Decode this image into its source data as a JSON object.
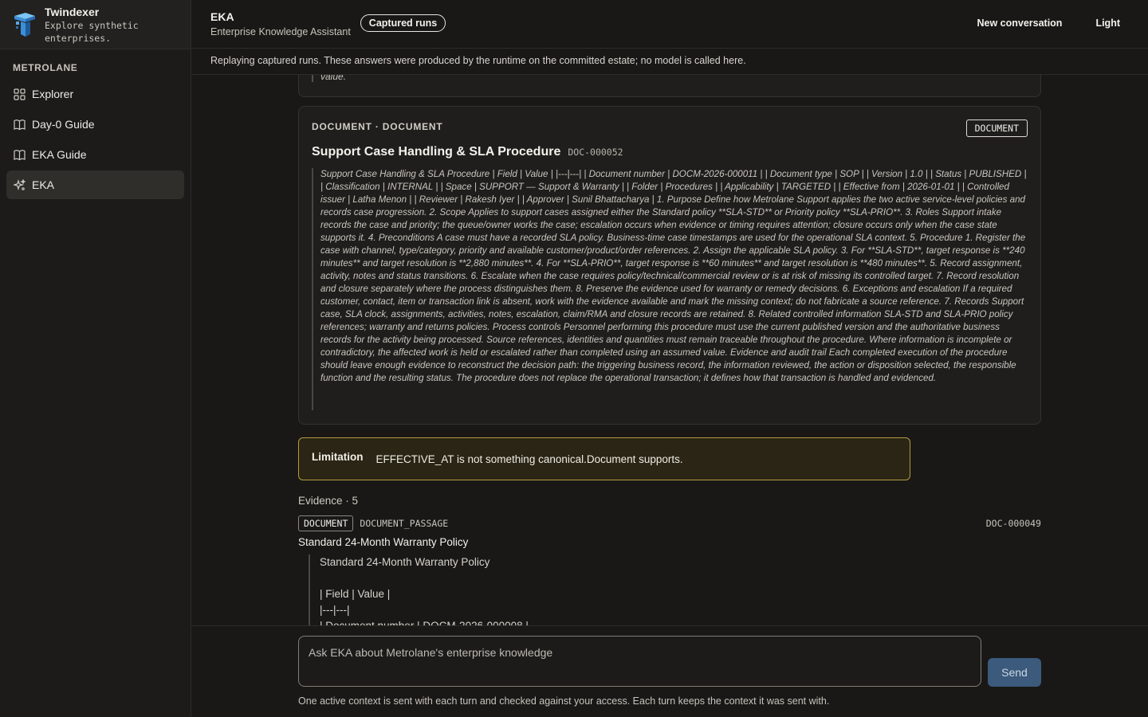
{
  "brand": {
    "name": "Twindexer",
    "tagline": "Explore synthetic enterprises."
  },
  "sidebar": {
    "section": "METROLANE",
    "items": [
      {
        "label": "Explorer",
        "icon": "grid-icon"
      },
      {
        "label": "Day-0 Guide",
        "icon": "book-icon"
      },
      {
        "label": "EKA Guide",
        "icon": "book-icon"
      },
      {
        "label": "EKA",
        "icon": "sparkle-icon",
        "active": true
      }
    ]
  },
  "header": {
    "title": "EKA",
    "subtitle": "Enterprise Knowledge Assistant",
    "badge": "Captured runs",
    "new_conversation": "New conversation",
    "theme": "Light"
  },
  "notice": "Replaying captured runs. These answers were produced by the runtime on the committed estate; no model is called here.",
  "previous_tail": "value.",
  "document": {
    "kicker": "DOCUMENT · DOCUMENT",
    "tag": "DOCUMENT",
    "title": "Support Case Handling & SLA Procedure",
    "id": "DOC-000052",
    "body": "Support Case Handling & SLA Procedure | Field | Value | |---|---| | Document number | DOCM-2026-000011 | | Document type | SOP | | Version | 1.0 | | Status | PUBLISHED | | Classification | INTERNAL | | Space | SUPPORT — Support & Warranty | | Folder | Procedures | | Applicability | TARGETED | | Effective from | 2026-01-01 | | Controlled issuer | Latha Menon | | Reviewer | Rakesh Iyer | | Approver | Sunil Bhattacharya | 1. Purpose Define how Metrolane Support applies the two active service-level policies and records case progression. 2. Scope Applies to support cases assigned either the Standard policy **SLA-STD** or Priority policy **SLA-PRIO**. 3. Roles Support intake records the case and priority; the queue/owner works the case; escalation occurs when evidence or timing requires attention; closure occurs only when the case state supports it. 4. Preconditions A case must have a recorded SLA policy. Business-time case timestamps are used for the operational SLA context. 5. Procedure 1. Register the case with channel, type/category, priority and available customer/product/order references. 2. Assign the applicable SLA policy. 3. For **SLA-STD**, target response is **240 minutes** and target resolution is **2,880 minutes**. 4. For **SLA-PRIO**, target response is **60 minutes** and target resolution is **480 minutes**. 5. Record assignment, activity, notes and status transitions. 6. Escalate when the case requires policy/technical/commercial review or is at risk of missing its controlled target. 7. Record resolution and closure separately where the process distinguishes them. 8. Preserve the evidence used for warranty or remedy decisions. 6. Exceptions and escalation If a required customer, contact, item or transaction link is absent, work with the evidence available and mark the missing context; do not fabricate a source reference. 7. Records Support case, SLA clock, assignments, activities, notes, escalation, claim/RMA and closure records are retained. 8. Related controlled information SLA-STD and SLA-PRIO policy references; warranty and returns policies. Process controls Personnel performing this procedure must use the current published version and the authoritative business records for the activity being processed. Source references, identities and quantities must remain traceable throughout the procedure. Where information is incomplete or contradictory, the affected work is held or escalated rather than completed using an assumed value. Evidence and audit trail Each completed execution of the procedure should leave enough evidence to reconstruct the decision path: the triggering business record, the information reviewed, the action or disposition selected, the responsible function and the resulting status. The procedure does not replace the operational transaction; it defines how that transaction is handled and evidenced."
  },
  "limitation": {
    "label": "Limitation",
    "text": "EFFECTIVE_AT is not something canonical.Document supports."
  },
  "evidence": {
    "header": "Evidence · 5",
    "tag": "DOCUMENT",
    "type": "DOCUMENT_PASSAGE",
    "id": "DOC-000049",
    "title": "Standard 24-Month Warranty Policy",
    "body": "Standard 24-Month Warranty Policy\n\n| Field | Value |\n|---|---|\n| Document number | DOCM-2026-000008 |"
  },
  "composer": {
    "placeholder": "Ask EKA about Metrolane's enterprise knowledge",
    "send": "Send",
    "note": "One active context is sent with each turn and checked against your access. Each turn keeps the context it was sent with."
  },
  "colors": {
    "accent_send": "#3c5a7c",
    "limitation_border": "#b59a3e",
    "logo_blue": "#3b8fd8"
  }
}
